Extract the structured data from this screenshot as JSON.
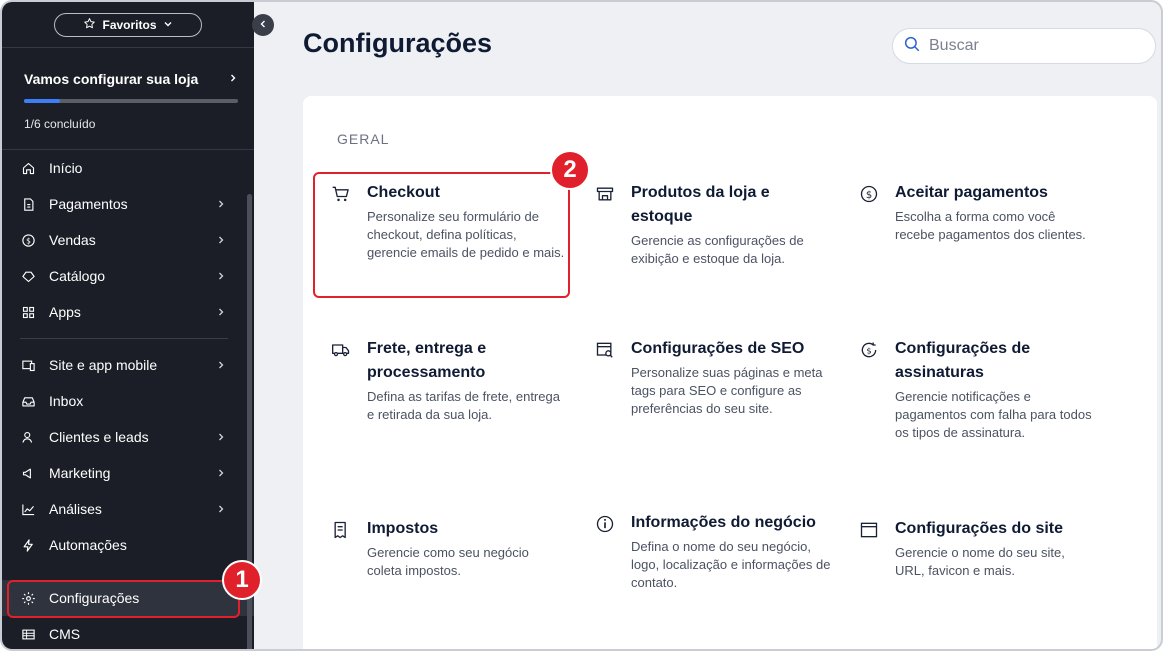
{
  "sidebar": {
    "favorites_label": "Favoritos",
    "setup": {
      "title": "Vamos configurar sua loja",
      "progress_text": "1/6 concluído",
      "progress_fraction": 0.1667
    },
    "items": [
      {
        "label": "Início",
        "icon": "home-icon",
        "chevron": false
      },
      {
        "label": "Pagamentos",
        "icon": "payments-icon",
        "chevron": true
      },
      {
        "label": "Vendas",
        "icon": "dollar-circle-icon",
        "chevron": true
      },
      {
        "label": "Catálogo",
        "icon": "catalog-icon",
        "chevron": true
      },
      {
        "label": "Apps",
        "icon": "apps-icon",
        "chevron": true
      },
      {
        "label": "Site e app mobile",
        "icon": "site-icon",
        "chevron": true
      },
      {
        "label": "Inbox",
        "icon": "inbox-icon",
        "chevron": false
      },
      {
        "label": "Clientes e leads",
        "icon": "people-icon",
        "chevron": true
      },
      {
        "label": "Marketing",
        "icon": "marketing-icon",
        "chevron": true
      },
      {
        "label": "Análises",
        "icon": "analytics-icon",
        "chevron": true
      },
      {
        "label": "Automações",
        "icon": "lightning-icon",
        "chevron": false
      },
      {
        "label": "Configurações",
        "icon": "gear-icon",
        "chevron": false,
        "active": true
      },
      {
        "label": "CMS",
        "icon": "cms-icon",
        "chevron": false
      }
    ]
  },
  "header": {
    "title": "Configurações",
    "search_placeholder": "Buscar"
  },
  "main": {
    "section_title": "GERAL",
    "cards": [
      {
        "title": "Checkout",
        "desc": "Personalize seu formulário de checkout, defina políticas, gerencie emails de pedido e mais.",
        "icon": "cart-icon"
      },
      {
        "title": "Produtos da loja e estoque",
        "desc": "Gerencie as configurações de exibição e estoque da loja.",
        "icon": "store-icon"
      },
      {
        "title": "Aceitar pagamentos",
        "desc": "Escolha a forma como você recebe pagamentos dos clientes.",
        "icon": "dollar-circle-icon"
      },
      {
        "title": "Frete, entrega e processamento",
        "desc": "Defina as tarifas de frete, entrega e retirada da sua loja.",
        "icon": "truck-icon"
      },
      {
        "title": "Configurações de SEO",
        "desc": "Personalize suas páginas e meta tags para SEO e configure as preferências do seu site.",
        "icon": "seo-icon"
      },
      {
        "title": "Configurações de assinaturas",
        "desc": "Gerencie notificações e pagamentos com falha para todos os tipos de assinatura.",
        "icon": "subscription-icon"
      },
      {
        "title": "Impostos",
        "desc": "Gerencie como seu negócio coleta impostos.",
        "icon": "tax-icon"
      },
      {
        "title": "Informações do negócio",
        "desc": "Defina o nome do seu negócio, logo, localização e informações de contato.",
        "icon": "info-icon"
      },
      {
        "title": "Configurações do site",
        "desc": "Gerencie o nome do seu site, URL, favicon e mais.",
        "icon": "browser-window-icon"
      }
    ]
  },
  "annotations": [
    {
      "label": "1"
    },
    {
      "label": "2"
    }
  ],
  "colors": {
    "sidebar_bg": "#1b1e27",
    "accent": "#3d7df5",
    "highlight": "#e0212b",
    "page_bg": "#eef0f4"
  }
}
